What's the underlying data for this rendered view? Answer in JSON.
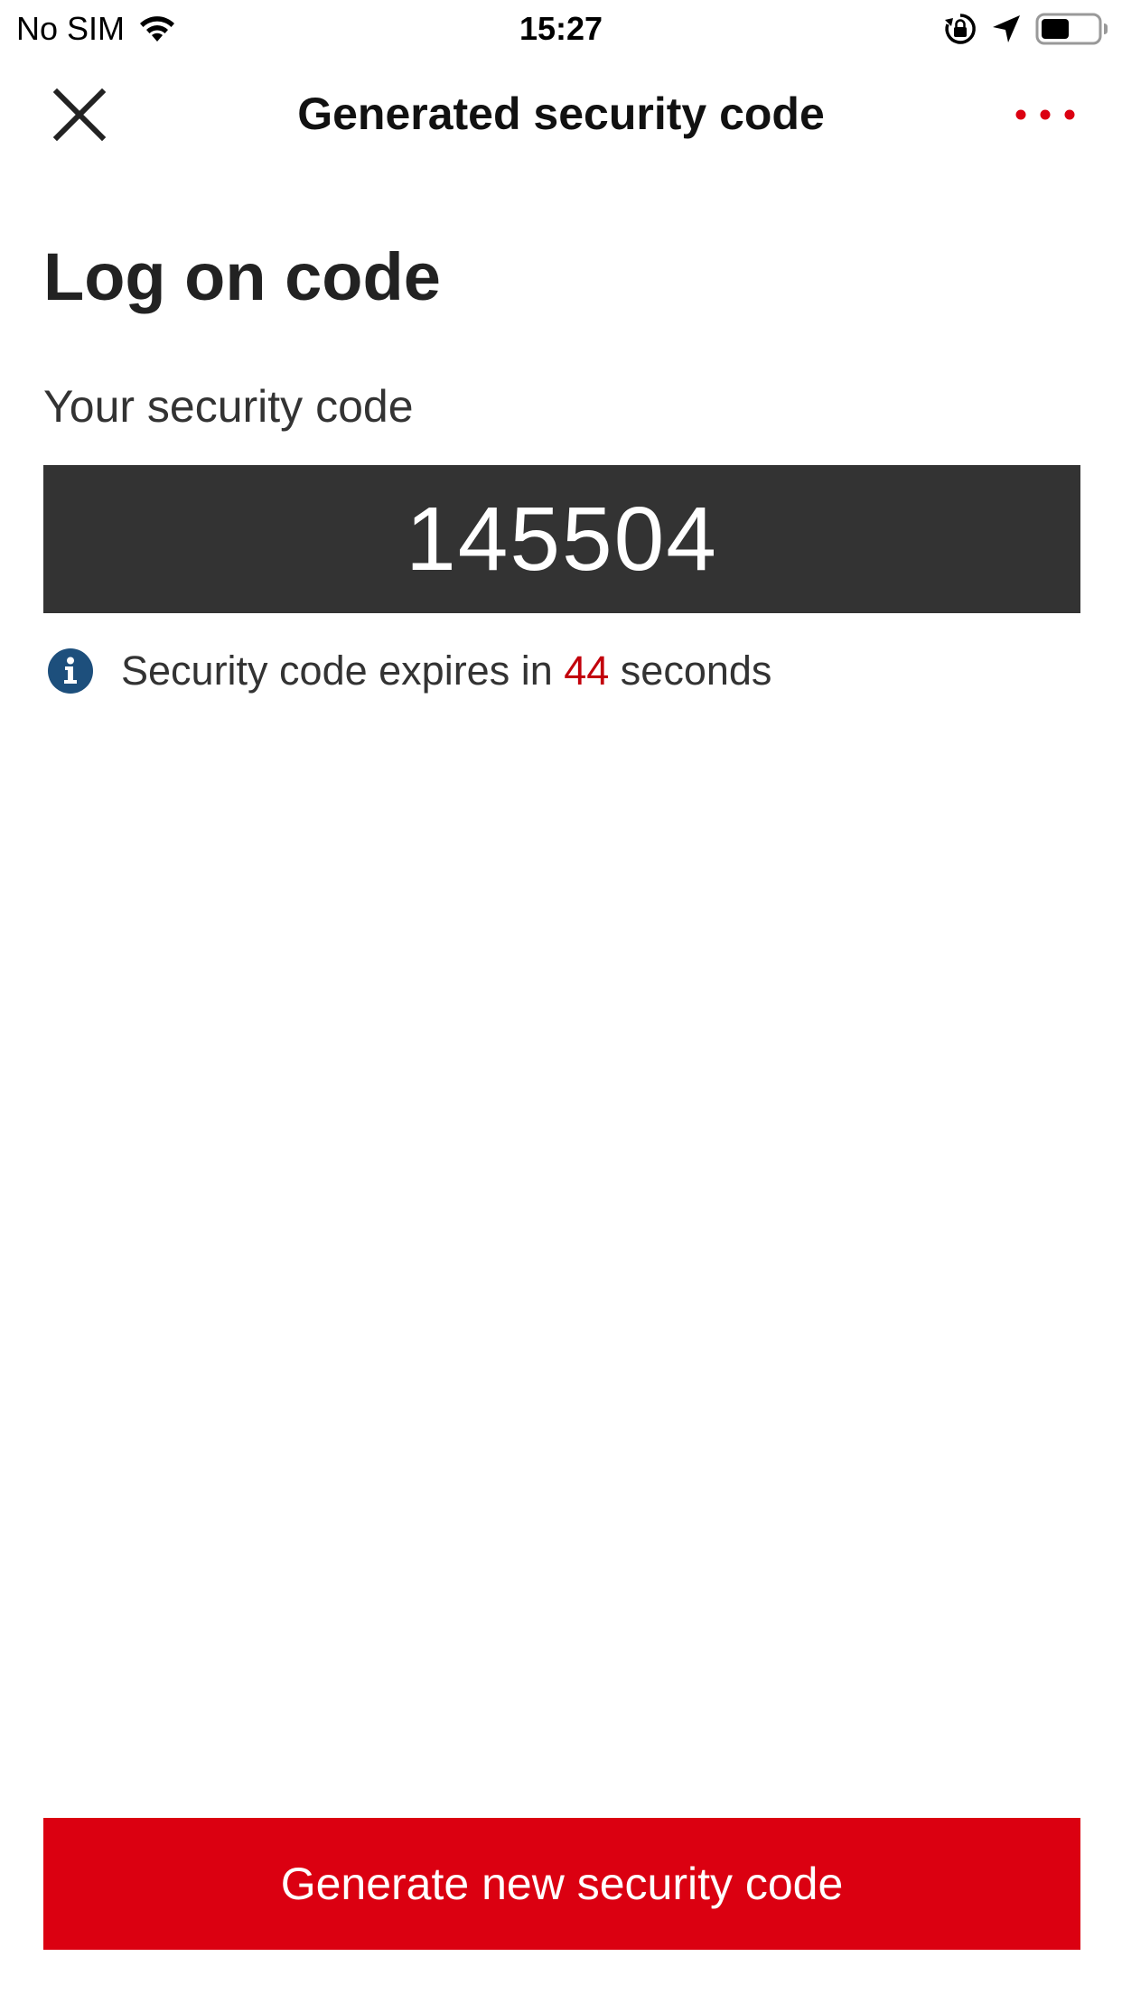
{
  "status_bar": {
    "carrier": "No SIM",
    "time": "15:27",
    "icons": [
      "wifi-icon",
      "orientation-lock-icon",
      "location-arrow-icon",
      "battery-icon"
    ],
    "battery_level": 0.5
  },
  "nav": {
    "title": "Generated security code",
    "close_icon": "close-icon",
    "more_icon": "more-dots-icon"
  },
  "content": {
    "heading": "Log on code",
    "code_label": "Your security code",
    "code": "145504",
    "expiry_prefix": "Security code expires in ",
    "expiry_seconds": "44",
    "expiry_suffix": " seconds"
  },
  "actions": {
    "generate_label": "Generate new security code"
  },
  "colors": {
    "brand_red": "#db0011",
    "countdown_red": "#c2000b",
    "code_box": "#333333",
    "info_blue": "#1d4f7c"
  }
}
